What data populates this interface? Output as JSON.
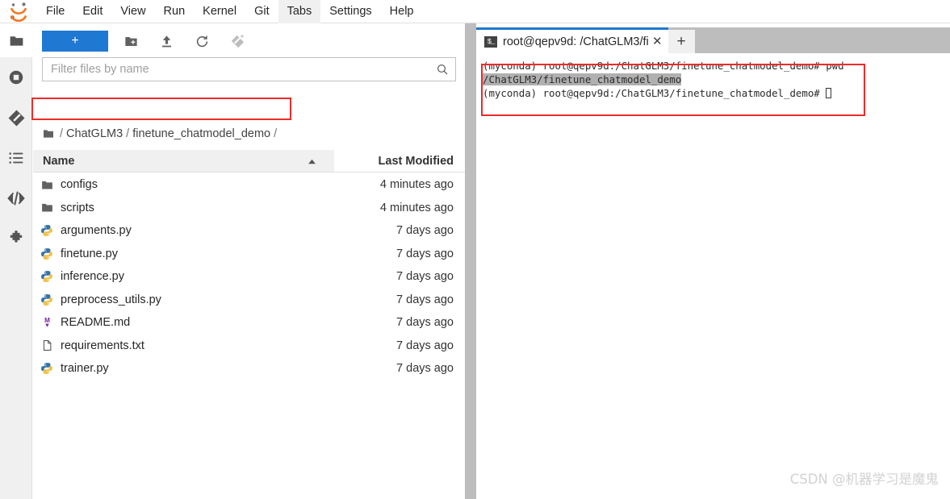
{
  "app": {
    "logo_name": "jupyter-logo",
    "accent_blue": "#1f78d1",
    "annotation_red": "#ee2a2a",
    "tabbar_gray": "#bdbdbd"
  },
  "menubar": {
    "items": [
      {
        "label": "File",
        "active": false
      },
      {
        "label": "Edit",
        "active": false
      },
      {
        "label": "View",
        "active": false
      },
      {
        "label": "Run",
        "active": false
      },
      {
        "label": "Kernel",
        "active": false
      },
      {
        "label": "Git",
        "active": false
      },
      {
        "label": "Tabs",
        "active": true
      },
      {
        "label": "Settings",
        "active": false
      },
      {
        "label": "Help",
        "active": false
      }
    ]
  },
  "sidebar": {
    "items": [
      {
        "name": "file-browser-icon",
        "title": "File Browser",
        "active": true
      },
      {
        "name": "running-sessions-icon",
        "title": "Running Terminals and Kernels",
        "active": false
      },
      {
        "name": "git-icon",
        "title": "Git",
        "active": false
      },
      {
        "name": "table-of-contents-icon",
        "title": "Table of Contents",
        "active": false
      },
      {
        "name": "code-icon",
        "title": "Debugger",
        "active": false
      },
      {
        "name": "extension-manager-icon",
        "title": "Extension Manager",
        "active": false
      }
    ]
  },
  "filebrowser": {
    "new_launcher_label": "+",
    "toolbar_buttons": [
      {
        "name": "new-folder-icon",
        "title": "New Folder",
        "dim": false
      },
      {
        "name": "upload-icon",
        "title": "Upload Files",
        "dim": false
      },
      {
        "name": "refresh-icon",
        "title": "Refresh File List",
        "dim": false
      },
      {
        "name": "new-checkpoint-icon",
        "title": "New Checkpoint",
        "dim": true
      }
    ],
    "filter": {
      "value": "",
      "placeholder": "Filter files by name"
    },
    "breadcrumb": {
      "leading_separator": "/",
      "crumbs": [
        "ChatGLM3",
        "finetune_chatmodel_demo"
      ],
      "trailing_separator": "/"
    },
    "columns": {
      "name": "Name",
      "last_modified": "Last Modified",
      "sort_direction": "ascending"
    },
    "rows": [
      {
        "icon": "folder-icon",
        "name": "configs",
        "modified": "4 minutes ago"
      },
      {
        "icon": "folder-icon",
        "name": "scripts",
        "modified": "4 minutes ago"
      },
      {
        "icon": "python-file-icon",
        "name": "arguments.py",
        "modified": "7 days ago"
      },
      {
        "icon": "python-file-icon",
        "name": "finetune.py",
        "modified": "7 days ago"
      },
      {
        "icon": "python-file-icon",
        "name": "inference.py",
        "modified": "7 days ago"
      },
      {
        "icon": "python-file-icon",
        "name": "preprocess_utils.py",
        "modified": "7 days ago"
      },
      {
        "icon": "markdown-file-icon",
        "name": "README.md",
        "modified": "7 days ago"
      },
      {
        "icon": "text-file-icon",
        "name": "requirements.txt",
        "modified": "7 days ago"
      },
      {
        "icon": "python-file-icon",
        "name": "trainer.py",
        "modified": "7 days ago"
      }
    ]
  },
  "dock": {
    "tabs": [
      {
        "icon": "terminal-icon",
        "icon_glyph": "$_",
        "label": "root@qepv9d: /ChatGLM3/fi",
        "close_glyph": "✕",
        "active": true
      }
    ],
    "add_tab_label": "+"
  },
  "terminal": {
    "lines": [
      {
        "text": "(myconda) root@qepv9d:/ChatGLM3/finetune_chatmodel_demo# pwd",
        "selected": false
      },
      {
        "text": "/ChatGLM3/finetune_chatmodel_demo",
        "selected": true
      },
      {
        "text": "(myconda) root@qepv9d:/ChatGLM3/finetune_chatmodel_demo# ",
        "selected": false,
        "cursor": true
      }
    ]
  },
  "watermark": {
    "text": "CSDN @机器学习是魔鬼"
  }
}
